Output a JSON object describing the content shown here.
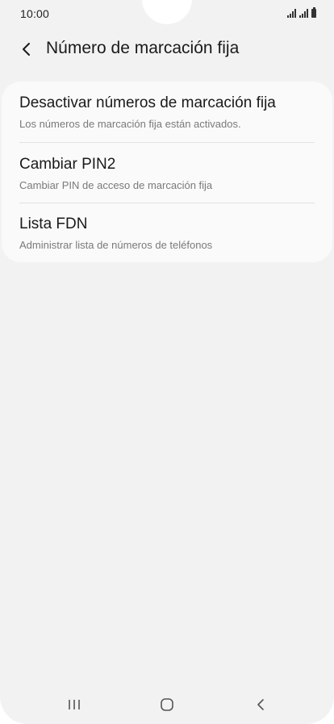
{
  "status_bar": {
    "time": "10:00"
  },
  "header": {
    "title": "Número de marcación fija",
    "back_icon": "chevron-left-icon"
  },
  "settings": {
    "items": [
      {
        "title": "Desactivar números de marcación fija",
        "subtitle": "Los números de marcación fija están activados."
      },
      {
        "title": "Cambiar PIN2",
        "subtitle": "Cambiar PIN de acceso de marcación fija"
      },
      {
        "title": "Lista FDN",
        "subtitle": "Administrar lista de números de teléfonos"
      }
    ]
  },
  "nav_bar": {
    "recents_icon": "recents-icon",
    "home_icon": "home-icon",
    "back_icon": "back-icon"
  },
  "colors": {
    "background": "#f2f2f2",
    "card": "#fafafa",
    "title_text": "#1a1a1a",
    "subtitle_text": "#7a7a7a"
  }
}
